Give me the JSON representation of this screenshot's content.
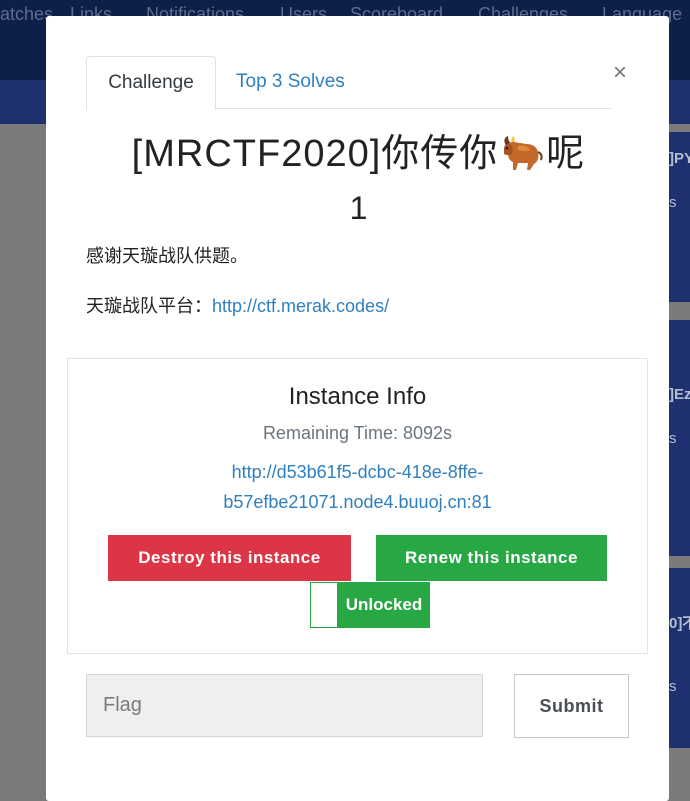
{
  "background": {
    "nav": [
      "atches",
      "Links",
      "Notifications",
      "Users",
      "Scoreboard",
      "Challenges",
      "Language"
    ],
    "cards": [
      {
        "title": "]PY",
        "sub": "s"
      },
      {
        "title": "]Ez",
        "sub": "s"
      },
      {
        "title": "0]不",
        "sub": "s"
      }
    ]
  },
  "modal": {
    "tabs": [
      {
        "label": "Challenge",
        "active": true
      },
      {
        "label": "Top 3 Solves",
        "active": false
      }
    ],
    "close_label": "×",
    "title_before": "[MRCTF2020]你传你",
    "title_icon": "ox-emoji-icon",
    "title_after": "呢",
    "title_line2": "1",
    "description_line1": "感谢天璇战队供题。",
    "description_line2_label": "天璇战队平台：",
    "description_line2_link": "http://ctf.merak.codes/"
  },
  "instance": {
    "title": "Instance Info",
    "remaining": "Remaining Time: 8092s",
    "link_line1": "http://d53b61f5-dcbc-418e-8ffe-",
    "link_line2": "b57efbe21071.node4.buuoj.cn:81",
    "destroy_label": "Destroy this instance",
    "renew_label": "Renew this instance",
    "unlock_label": "Unlocked"
  },
  "form": {
    "flag_placeholder": "Flag",
    "flag_value": "",
    "submit_label": "Submit"
  },
  "colors": {
    "danger": "#dc3545",
    "success": "#28a745",
    "link": "#2f80c0",
    "nav": "#0e1f4a"
  }
}
